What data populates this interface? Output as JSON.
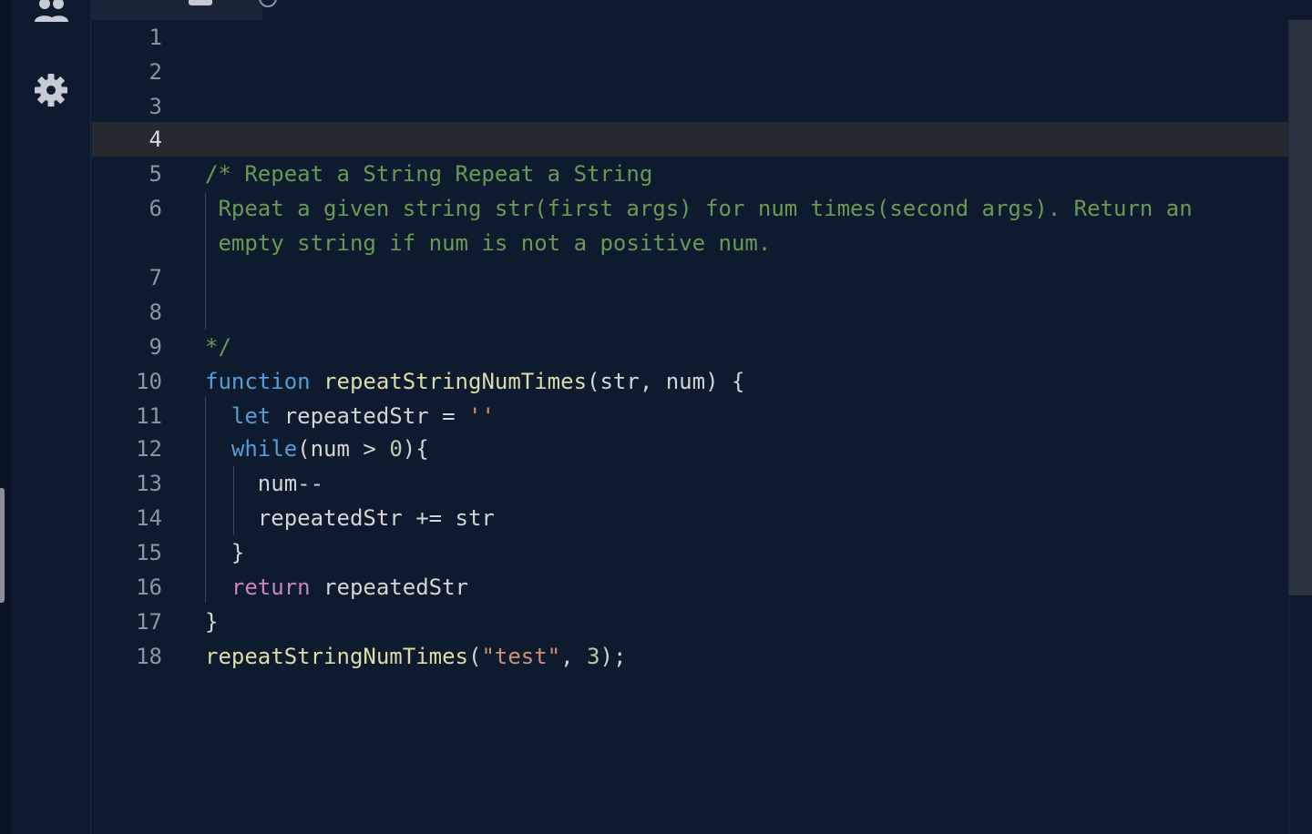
{
  "editor": {
    "active_line": "4",
    "lines": [
      {
        "n": "1",
        "tokens": []
      },
      {
        "n": "2",
        "tokens": []
      },
      {
        "n": "3",
        "tokens": []
      },
      {
        "n": "4",
        "tokens": []
      },
      {
        "n": "5",
        "tokens": [
          {
            "t": "/* Repeat a String Repeat a String",
            "c": "comment"
          }
        ]
      },
      {
        "n": "6",
        "tokens": [
          {
            "t": " Rpeat a given string str(first args) for num times(second args). Return an",
            "c": "comment"
          }
        ]
      },
      {
        "n": "",
        "tokens": [
          {
            "t": " empty string if num is not a positive num.",
            "c": "comment"
          }
        ]
      },
      {
        "n": "7",
        "tokens": []
      },
      {
        "n": "8",
        "tokens": []
      },
      {
        "n": "9",
        "tokens": [
          {
            "t": "*/",
            "c": "comment"
          }
        ]
      },
      {
        "n": "10",
        "tokens": [
          {
            "t": "function",
            "c": "kw"
          },
          {
            "t": " ",
            "c": "plain"
          },
          {
            "t": "repeatStringNumTimes",
            "c": "fn"
          },
          {
            "t": "(str, num) {",
            "c": "plain"
          }
        ]
      },
      {
        "n": "11",
        "tokens": [
          {
            "t": "  ",
            "c": "plain"
          },
          {
            "t": "let",
            "c": "kw"
          },
          {
            "t": " repeatedStr = ",
            "c": "plain"
          },
          {
            "t": "''",
            "c": "str"
          }
        ]
      },
      {
        "n": "12",
        "tokens": [
          {
            "t": "  ",
            "c": "plain"
          },
          {
            "t": "while",
            "c": "kw"
          },
          {
            "t": "(num > ",
            "c": "plain"
          },
          {
            "t": "0",
            "c": "num"
          },
          {
            "t": "){",
            "c": "plain"
          }
        ]
      },
      {
        "n": "13",
        "tokens": [
          {
            "t": "    num--",
            "c": "plain"
          }
        ]
      },
      {
        "n": "14",
        "tokens": [
          {
            "t": "    repeatedStr += str",
            "c": "plain"
          }
        ]
      },
      {
        "n": "15",
        "tokens": [
          {
            "t": "  }",
            "c": "plain"
          }
        ]
      },
      {
        "n": "16",
        "tokens": [
          {
            "t": "  ",
            "c": "plain"
          },
          {
            "t": "return",
            "c": "kw2"
          },
          {
            "t": " repeatedStr",
            "c": "plain"
          }
        ]
      },
      {
        "n": "17",
        "tokens": [
          {
            "t": "}",
            "c": "plain"
          }
        ]
      },
      {
        "n": "18",
        "tokens": [
          {
            "t": "repeatStringNumTimes",
            "c": "fn"
          },
          {
            "t": "(",
            "c": "plain"
          },
          {
            "t": "\"test\"",
            "c": "str"
          },
          {
            "t": ", ",
            "c": "plain"
          },
          {
            "t": "3",
            "c": "num"
          },
          {
            "t": ");",
            "c": "plain"
          }
        ]
      }
    ]
  },
  "icons": {
    "users": "users-icon",
    "settings": "gear-icon"
  },
  "colors": {
    "background": "#0e1a2d",
    "comment": "#6a9955",
    "keyword": "#569cd6",
    "control": "#c586c0",
    "function": "#dcdcaa",
    "string": "#ce9178",
    "number": "#b5cea8"
  }
}
